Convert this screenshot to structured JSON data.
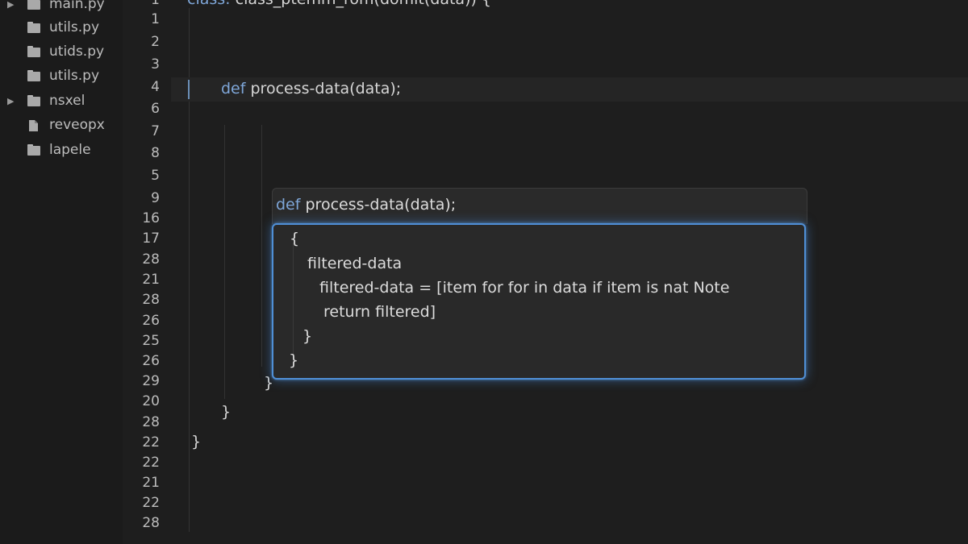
{
  "sidebar": {
    "items": [
      {
        "label": "main.py",
        "expandable": true,
        "icon": "folder-icon"
      },
      {
        "label": "utils.py",
        "expandable": false,
        "icon": "folder-icon"
      },
      {
        "label": "utids.py",
        "expandable": false,
        "icon": "folder-icon"
      },
      {
        "label": "utils.py",
        "expandable": false,
        "icon": "folder-icon"
      },
      {
        "label": "nsxel",
        "expandable": true,
        "icon": "folder-icon"
      },
      {
        "label": "reveopx",
        "expandable": false,
        "icon": "file-icon"
      },
      {
        "label": "lapele",
        "expandable": false,
        "icon": "folder-icon"
      }
    ]
  },
  "gutter": {
    "line_numbers": [
      "1",
      "2",
      "3",
      "4",
      "6",
      "7",
      "8",
      "5",
      "9",
      "16",
      "17",
      "28",
      "21",
      "28",
      "26",
      "25",
      "26",
      "29",
      "20",
      "28",
      "22",
      "22",
      "21",
      "22",
      "28"
    ]
  },
  "editor": {
    "top_line": {
      "keyword": "class:",
      "rest": " class_ptemm_rom(domit(data)) {"
    },
    "def_line": {
      "keyword": "def",
      "rest": " process-data(data);"
    },
    "brace_inner": "}",
    "brace_middle": "}",
    "brace_outer": "}"
  },
  "peek": {
    "header": {
      "keyword": "def",
      "rest": " process-data(data);"
    },
    "lines": [
      "{",
      "filtered-data",
      "filtered-data = [item for for in data if item is nat Note",
      "return filtered]",
      "}",
      "}"
    ]
  },
  "colors": {
    "background": "#1e1e1e",
    "keyword": "#7ea6d8",
    "accent_border": "#4f8fd6"
  }
}
